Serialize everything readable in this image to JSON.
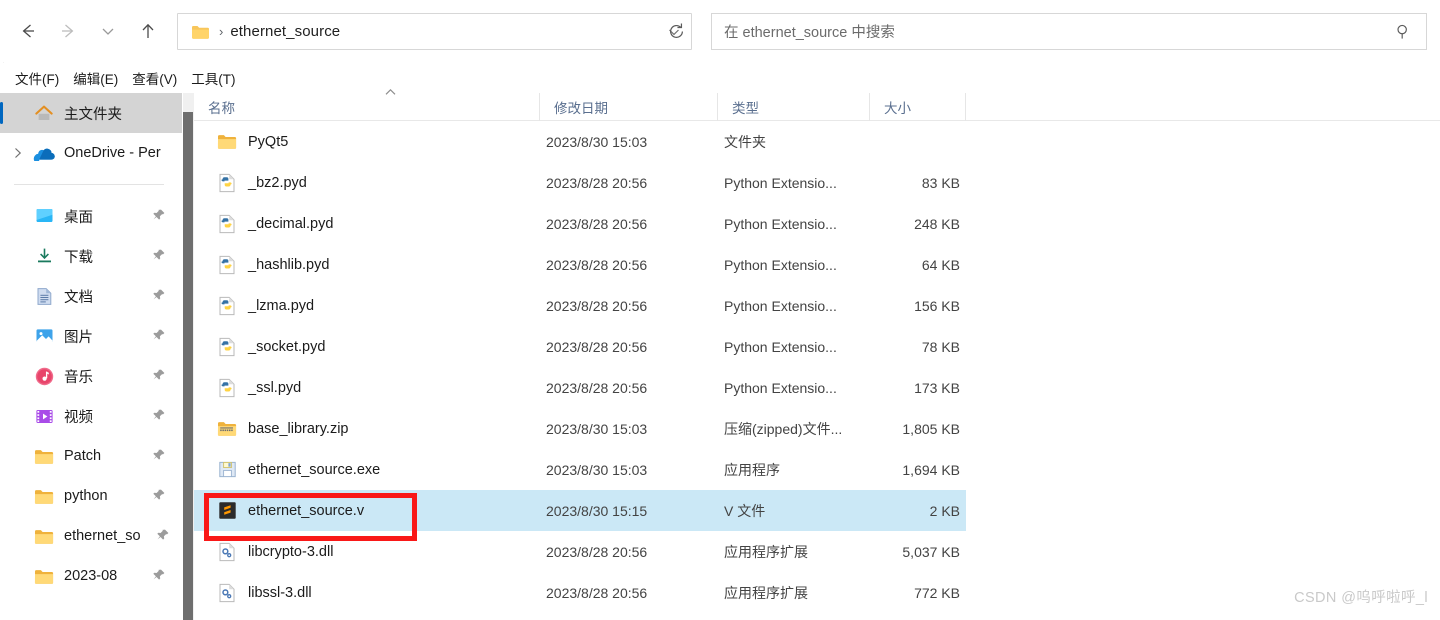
{
  "window": {
    "title": "ethernet_source",
    "watermark": "CSDN @呜呼啦呼_l"
  },
  "toolbar": {
    "back_label": "back-arrow",
    "forward_label": "forward-arrow",
    "recent_label": "recent-locations-chevron",
    "up_label": "up-arrow",
    "address": {
      "path_text": "ethernet_source",
      "separator": "›",
      "dropdown_label": "previous-locations",
      "refresh_label": "refresh"
    },
    "search": {
      "placeholder": "在 ethernet_source 中搜索",
      "icon": "search-icon"
    }
  },
  "menubar": {
    "items": [
      {
        "label": "文件(F)"
      },
      {
        "label": "编辑(E)"
      },
      {
        "label": "查看(V)"
      },
      {
        "label": "工具(T)"
      }
    ]
  },
  "sidebar": {
    "items": [
      {
        "label": "主文件夹",
        "icon": "home-icon",
        "selected": true,
        "pinned": false,
        "expander": false
      },
      {
        "label": "OneDrive - Per",
        "icon": "onedrive-cloud-icon",
        "selected": false,
        "pinned": false,
        "expander": true
      }
    ],
    "quick_access": [
      {
        "label": "桌面",
        "icon": "desktop-icon",
        "pinned": true
      },
      {
        "label": "下载",
        "icon": "downloads-icon",
        "pinned": true
      },
      {
        "label": "文档",
        "icon": "documents-icon",
        "pinned": true
      },
      {
        "label": "图片",
        "icon": "pictures-icon",
        "pinned": true
      },
      {
        "label": "音乐",
        "icon": "music-icon",
        "pinned": true
      },
      {
        "label": "视频",
        "icon": "videos-icon",
        "pinned": true
      },
      {
        "label": "Patch",
        "icon": "folder-icon",
        "pinned": true
      },
      {
        "label": "python",
        "icon": "folder-icon",
        "pinned": true
      },
      {
        "label": "ethernet_so",
        "icon": "folder-icon",
        "pinned": true
      },
      {
        "label": "2023-08",
        "icon": "folder-icon",
        "pinned": true
      }
    ]
  },
  "filelist": {
    "columns": [
      {
        "label": "名称",
        "sort": "ascending"
      },
      {
        "label": "修改日期",
        "sort": null
      },
      {
        "label": "类型",
        "sort": null
      },
      {
        "label": "大小",
        "sort": null
      }
    ],
    "rows": [
      {
        "name": "PyQt5",
        "date": "2023/8/30 15:03",
        "type": "文件夹",
        "size": "",
        "icon": "folder-icon",
        "selected": false
      },
      {
        "name": "_bz2.pyd",
        "date": "2023/8/28 20:56",
        "type": "Python Extensio...",
        "size": "83 KB",
        "icon": "python-file-icon",
        "selected": false
      },
      {
        "name": "_decimal.pyd",
        "date": "2023/8/28 20:56",
        "type": "Python Extensio...",
        "size": "248 KB",
        "icon": "python-file-icon",
        "selected": false
      },
      {
        "name": "_hashlib.pyd",
        "date": "2023/8/28 20:56",
        "type": "Python Extensio...",
        "size": "64 KB",
        "icon": "python-file-icon",
        "selected": false
      },
      {
        "name": "_lzma.pyd",
        "date": "2023/8/28 20:56",
        "type": "Python Extensio...",
        "size": "156 KB",
        "icon": "python-file-icon",
        "selected": false
      },
      {
        "name": "_socket.pyd",
        "date": "2023/8/28 20:56",
        "type": "Python Extensio...",
        "size": "78 KB",
        "icon": "python-file-icon",
        "selected": false
      },
      {
        "name": "_ssl.pyd",
        "date": "2023/8/28 20:56",
        "type": "Python Extensio...",
        "size": "173 KB",
        "icon": "python-file-icon",
        "selected": false
      },
      {
        "name": "base_library.zip",
        "date": "2023/8/30 15:03",
        "type": "压缩(zipped)文件...",
        "size": "1,805 KB",
        "icon": "zip-file-icon",
        "selected": false
      },
      {
        "name": "ethernet_source.exe",
        "date": "2023/8/30 15:03",
        "type": "应用程序",
        "size": "1,694 KB",
        "icon": "application-icon",
        "selected": false
      },
      {
        "name": "ethernet_source.v",
        "date": "2023/8/30 15:15",
        "type": "V 文件",
        "size": "2 KB",
        "icon": "sublime-file-icon",
        "selected": true
      },
      {
        "name": "libcrypto-3.dll",
        "date": "2023/8/28 20:56",
        "type": "应用程序扩展",
        "size": "5,037 KB",
        "icon": "dll-file-icon",
        "selected": false
      },
      {
        "name": "libssl-3.dll",
        "date": "2023/8/28 20:56",
        "type": "应用程序扩展",
        "size": "772 KB",
        "icon": "dll-file-icon",
        "selected": false
      }
    ]
  },
  "annotation": {
    "highlight_color": "#f91818",
    "target_row": "ethernet_source.v"
  },
  "colors": {
    "selection": "#cbe8f6",
    "accent": "#0067c0",
    "header_text": "#5a6f8f",
    "annotation": "#f91818"
  }
}
